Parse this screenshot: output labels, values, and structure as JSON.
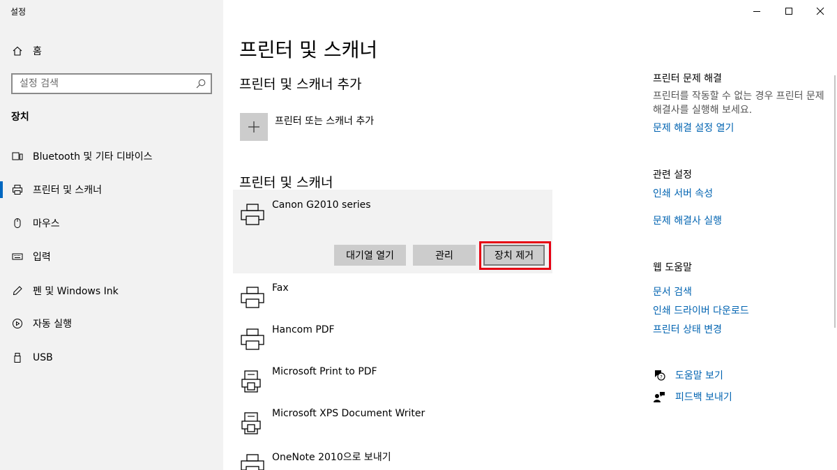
{
  "window": {
    "title": "설정"
  },
  "sidebar": {
    "home_label": "홈",
    "search_placeholder": "설정 검색",
    "section_heading": "장치",
    "items": [
      {
        "label": "Bluetooth 및 기타 디바이스",
        "icon": "devices-icon"
      },
      {
        "label": "프린터 및 스캐너",
        "icon": "printer-icon",
        "active": true
      },
      {
        "label": "마우스",
        "icon": "mouse-icon"
      },
      {
        "label": "입력",
        "icon": "keyboard-icon"
      },
      {
        "label": "펜 및 Windows Ink",
        "icon": "pen-icon"
      },
      {
        "label": "자동 실행",
        "icon": "autoplay-icon"
      },
      {
        "label": "USB",
        "icon": "usb-icon"
      }
    ]
  },
  "main": {
    "title": "프린터 및 스캐너",
    "add_section_heading": "프린터 및 스캐너 추가",
    "add_label": "프린터 또는 스캐너 추가",
    "list_heading": "프린터 및 스캐너",
    "devices": [
      {
        "name": "Canon G2010 series",
        "icon": "printer-icon"
      },
      {
        "name": "Fax",
        "icon": "printer-icon"
      },
      {
        "name": "Hancom PDF",
        "icon": "printer-icon"
      },
      {
        "name": "Microsoft Print to PDF",
        "icon": "pdf-printer-icon"
      },
      {
        "name": "Microsoft XPS Document Writer",
        "icon": "pdf-printer-icon"
      },
      {
        "name": "OneNote 2010으로 보내기",
        "icon": "printer-icon"
      }
    ],
    "buttons": {
      "open_queue": "대기열 열기",
      "manage": "관리",
      "remove_device": "장치 제거"
    }
  },
  "right_panel": {
    "troubleshoot_heading": "프린터 문제 해결",
    "troubleshoot_text": "프린터를 작동할 수 없는 경우 프린터 문제 해결사를 실행해 보세요.",
    "troubleshoot_link": "문제 해결 설정 열기",
    "related_heading": "관련 설정",
    "related_links": [
      "인쇄 서버 속성",
      "문제 해결사 실행"
    ],
    "web_help_heading": "웹 도움말",
    "web_help_links": [
      "문서 검색",
      "인쇄 드라이버 다운로드",
      "프린터 상태 변경"
    ],
    "get_help": "도움말 보기",
    "give_feedback": "피드백 보내기"
  },
  "colors": {
    "accent": "#0067c0",
    "link": "#0063b1",
    "sidebar_bg": "#f2f2f2",
    "button_bg": "#cccccc",
    "highlight": "#e60012"
  }
}
